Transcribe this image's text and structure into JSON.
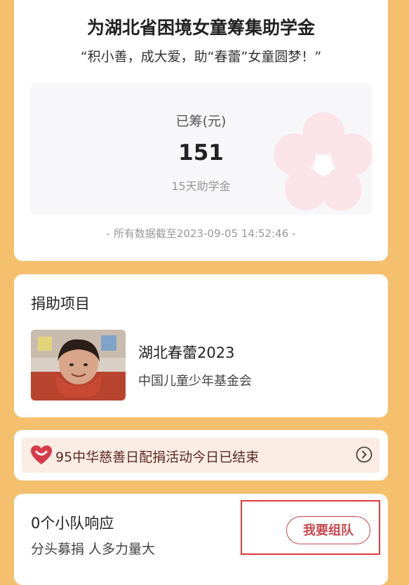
{
  "summary": {
    "title": "为湖北省困境女童筹集助学金",
    "subtitle": "“积小善，成大爱，助“春蕾”女童圆梦！”",
    "raised_label": "已筹(元)",
    "raised_value": "151",
    "days_label": "15天助学金",
    "data_time": "- 所有数据截至2023-09-05 14:52:46 -"
  },
  "project": {
    "section_title": "捐助项目",
    "name": "湖北春蕾2023",
    "org": "中国儿童少年基金会"
  },
  "notice": {
    "text": "95中华慈善日配捐活动今日已结束"
  },
  "team": {
    "count_text": "0个小队响应",
    "desc": "分头募捐 人多力量大",
    "button_label": "我要组队"
  },
  "colors": {
    "background": "#f5c06e",
    "accent": "#c9484e",
    "highlight": "#e03a3a"
  }
}
